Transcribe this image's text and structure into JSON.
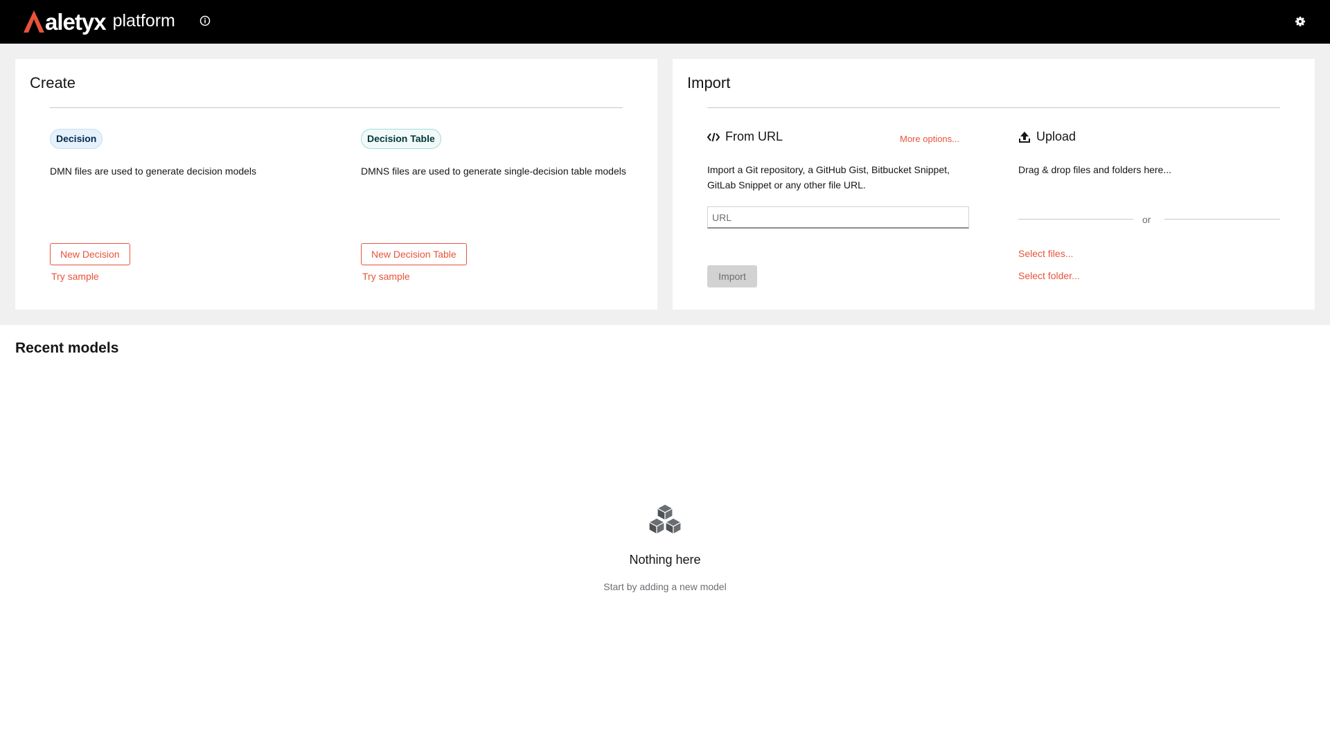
{
  "header": {
    "brand": "aletyx",
    "product": "platform",
    "logo_color": "#e8533b",
    "about_icon": "info-circle-icon",
    "settings_icon": "gear-icon"
  },
  "create": {
    "title": "Create",
    "decision": {
      "label": "Decision",
      "description": "DMN files are used to generate decision models",
      "button": "New Decision",
      "sample_link": "Try sample"
    },
    "decision_table": {
      "label": "Decision Table",
      "description": "DMNS files are used to generate single-decision table models",
      "button": "New Decision Table",
      "sample_link": "Try sample"
    }
  },
  "import": {
    "title": "Import",
    "from_url": {
      "heading": "From URL",
      "icon": "code-icon",
      "more_options": "More options...",
      "description": "Import a Git repository, a GitHub Gist, Bitbucket Snippet, GitLab Snippet or any other file URL.",
      "url_placeholder": "URL",
      "url_value": "",
      "import_button": "Import"
    },
    "upload": {
      "heading": "Upload",
      "icon": "upload-icon",
      "description": "Drag & drop files and folders here...",
      "or": "or",
      "select_files": "Select files...",
      "select_folder": "Select folder..."
    }
  },
  "recent": {
    "title": "Recent models",
    "empty_icon": "cubes-icon",
    "empty_title": "Nothing here",
    "empty_body": "Start by adding a new model"
  },
  "colors": {
    "accent": "#e8533b",
    "masthead": "#000000",
    "band": "#f0f0f0"
  }
}
